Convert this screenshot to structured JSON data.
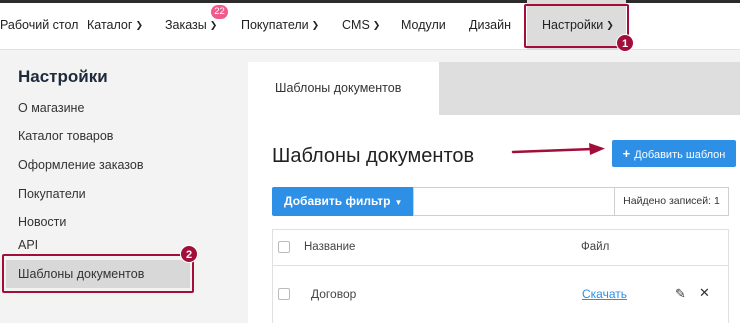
{
  "nav": {
    "items": [
      {
        "label": "Рабочий стол"
      },
      {
        "label": "Каталог"
      },
      {
        "label": "Заказы"
      },
      {
        "label": "Покупатели"
      },
      {
        "label": "CMS"
      },
      {
        "label": "Модули"
      },
      {
        "label": "Дизайн"
      },
      {
        "label": "Настройки"
      }
    ],
    "orders_badge": "22"
  },
  "callouts": {
    "one": "1",
    "two": "2"
  },
  "sidebar": {
    "title": "Настройки",
    "items": [
      {
        "label": "О магазине"
      },
      {
        "label": "Каталог товаров"
      },
      {
        "label": "Оформление заказов"
      },
      {
        "label": "Покупатели"
      },
      {
        "label": "Новости"
      },
      {
        "label": "API"
      },
      {
        "label": "Шаблоны документов"
      }
    ]
  },
  "main": {
    "tab_label": "Шаблоны документов",
    "page_title": "Шаблоны документов",
    "add_button": "Добавить шаблон",
    "filter_button": "Добавить фильтр",
    "filter_value": "",
    "found_records": "Найдено записей: 1",
    "table": {
      "headers": [
        "Название",
        "Файл"
      ],
      "rows": [
        {
          "name": "Договор",
          "file": "Скачать"
        }
      ]
    }
  },
  "colors": {
    "accent": "#2d8fe6",
    "callout": "#a10e3a",
    "badge": "#ef5a8d"
  }
}
